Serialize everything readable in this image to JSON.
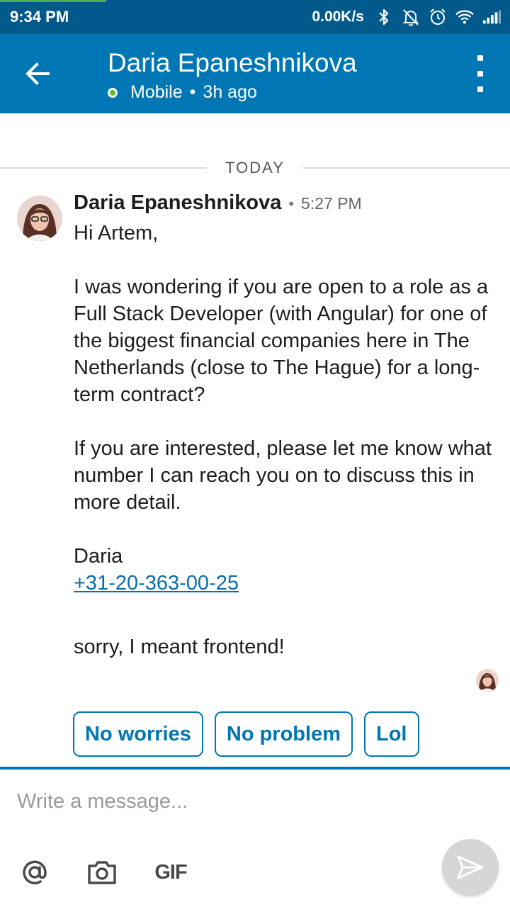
{
  "status_bar": {
    "time": "9:34 PM",
    "network_speed": "0.00K/s",
    "icons": [
      "bluetooth-icon",
      "notifications-off-icon",
      "alarm-icon",
      "wifi-icon",
      "signal-icon"
    ]
  },
  "header": {
    "contact_name": "Daria Epaneshnikova",
    "presence_device": "Mobile",
    "presence_separator": "•",
    "last_seen": "3h ago"
  },
  "date_divider": {
    "label": "TODAY"
  },
  "message": {
    "sender": "Daria Epaneshnikova",
    "separator": "•",
    "time": "5:27 PM",
    "greeting": "Hi Artem,",
    "paragraph_1": "I was wondering if you are open to a role as a Full Stack Developer (with Angular) for one of the biggest financial companies here in The Netherlands (close to The Hague) for a long-term contract?",
    "paragraph_2": "If you are interested, please let me know what number I can reach you on to discuss this in more detail.",
    "signature": "Daria",
    "phone": "+31-20-363-00-25",
    "followup": "sorry, I meant frontend!"
  },
  "smart_replies": [
    "No worries",
    "No problem",
    "Lol"
  ],
  "composer": {
    "placeholder": "Write a message...",
    "gif_label": "GIF"
  },
  "colors": {
    "status_bar": "#02598c",
    "app_bar": "#0077b5",
    "accent": "#0077b5",
    "link": "#0a6dab",
    "presence_online": "#5fbf2a",
    "send_button": "#d6d6d6"
  }
}
